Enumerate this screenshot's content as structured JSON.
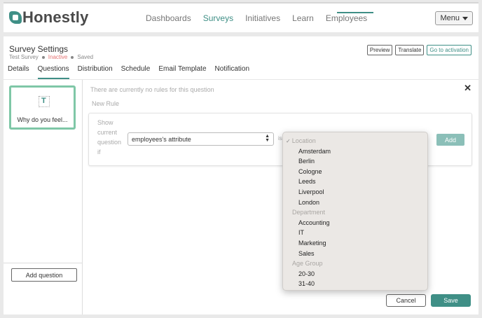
{
  "app": {
    "name": "Honestly"
  },
  "nav": {
    "items": [
      "Dashboards",
      "Surveys",
      "Initiatives",
      "Learn",
      "Employees"
    ],
    "active": "Surveys"
  },
  "menu": {
    "label": "Menu"
  },
  "page": {
    "title": "Survey Settings",
    "survey_name": "Test Survey",
    "status": "Inactive",
    "save_state": "Saved"
  },
  "actions": {
    "preview": "Preview",
    "translate": "Translate",
    "activation": "Go to activation"
  },
  "tabs": [
    "Details",
    "Questions",
    "Distribution",
    "Schedule",
    "Email Template",
    "Notification"
  ],
  "active_tab": "Questions",
  "sidebar": {
    "question_icon": "T",
    "question_label": "Why do you feel...",
    "add_question": "Add question"
  },
  "rules": {
    "empty_message": "There are currently no rules for this question",
    "new_rule": "New Rule",
    "show_label": "Show current question if",
    "attribute_select": "employees's attribute",
    "is_label": "is",
    "add_button": "Add"
  },
  "footer": {
    "cancel": "Cancel",
    "save": "Save"
  },
  "dropdown": {
    "items": [
      {
        "text": "Location",
        "group": true,
        "checked": true
      },
      {
        "text": "Amsterdam"
      },
      {
        "text": "Berlin"
      },
      {
        "text": "Cologne"
      },
      {
        "text": "Leeds"
      },
      {
        "text": "Liverpool"
      },
      {
        "text": "London"
      },
      {
        "text": "Department",
        "group": true
      },
      {
        "text": "Accounting"
      },
      {
        "text": "IT"
      },
      {
        "text": "Marketing"
      },
      {
        "text": "Sales"
      },
      {
        "text": "Age Group",
        "group": true
      },
      {
        "text": "20-30"
      },
      {
        "text": "31-40"
      }
    ]
  },
  "colors": {
    "accent": "#3f8f86",
    "inactive": "#e57373",
    "add_button": "#8bbfb8",
    "card_border": "#7fc7a7"
  },
  "icons": {
    "close": "close-icon",
    "check": "check-icon",
    "caret": "caret-down-icon"
  }
}
